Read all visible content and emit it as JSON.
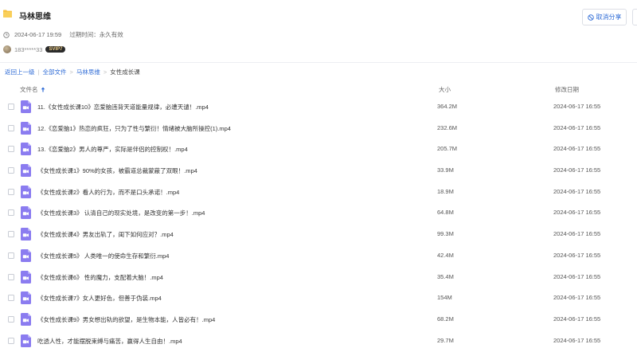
{
  "share": {
    "folder_title": "马林思维",
    "cancel_label": "取消分享",
    "created": "2024-06-17 19:59",
    "expire_label": "过期时间：",
    "expire_value": "永久有效",
    "user_name": "183*****33",
    "user_badge": "SVIP7"
  },
  "breadcrumb": {
    "back": "返回上一级",
    "sep1": "|",
    "all_files": "全部文件",
    "sep2": ">",
    "folder": "马林思维",
    "sep3": ">",
    "current": "女性成长课"
  },
  "table": {
    "headers": {
      "name": "文件名",
      "size": "大小",
      "date": "修改日期"
    },
    "rows": [
      {
        "name": "11.《女性成长课10》恋爱脑违背天道能量规律，必遭天谴！.mp4",
        "size": "364.2M",
        "date": "2024-06-17 16:55"
      },
      {
        "name": "12.《恋爱脑1》热恋的疯狂，只为了性与繁衍！情绪被大脑所操控(1).mp4",
        "size": "232.6M",
        "date": "2024-06-17 16:55"
      },
      {
        "name": "13.《恋爱脑2》男人的尊严，实际是伴侣的控制权！.mp4",
        "size": "205.7M",
        "date": "2024-06-17 16:55"
      },
      {
        "name": "《女性成长课1》90%的女孩，被霸道总裁蒙蔽了双眼！.mp4",
        "size": "33.9M",
        "date": "2024-06-17 16:55"
      },
      {
        "name": "《女性成长课2》看人的行为，而不是口头承诺！.mp4",
        "size": "18.9M",
        "date": "2024-06-17 16:55"
      },
      {
        "name": "《女性成长课3》 认清自己的现实处境，是改变的第一步！.mp4",
        "size": "64.8M",
        "date": "2024-06-17 16:55"
      },
      {
        "name": "《女性成长课4》男友出轨了，闺下如何应对？.mp4",
        "size": "99.3M",
        "date": "2024-06-17 16:55"
      },
      {
        "name": "《女性成长课5》 人类唯一的使命生存和繁衍.mp4",
        "size": "42.4M",
        "date": "2024-06-17 16:55"
      },
      {
        "name": "《女性成长课6》 性的魔力，支配着大脑！.mp4",
        "size": "35.4M",
        "date": "2024-06-17 16:55"
      },
      {
        "name": "《女性成长课7》女人更好色，但善于伪装.mp4",
        "size": "154M",
        "date": "2024-06-17 16:55"
      },
      {
        "name": "《女性成长课9》男女想出轨的欲望，是生物本能，人皆必有！.mp4",
        "size": "68.2M",
        "date": "2024-06-17 16:55"
      },
      {
        "name": "吃透人性，才能摆脱束缚与痛苦，赢得人生自由！.mp4",
        "size": "29.7M",
        "date": "2024-06-17 16:55"
      }
    ]
  },
  "colors": {
    "accent": "#2e6bd6",
    "video_icon": "#8b7cf0",
    "folder": "#f7c243"
  }
}
